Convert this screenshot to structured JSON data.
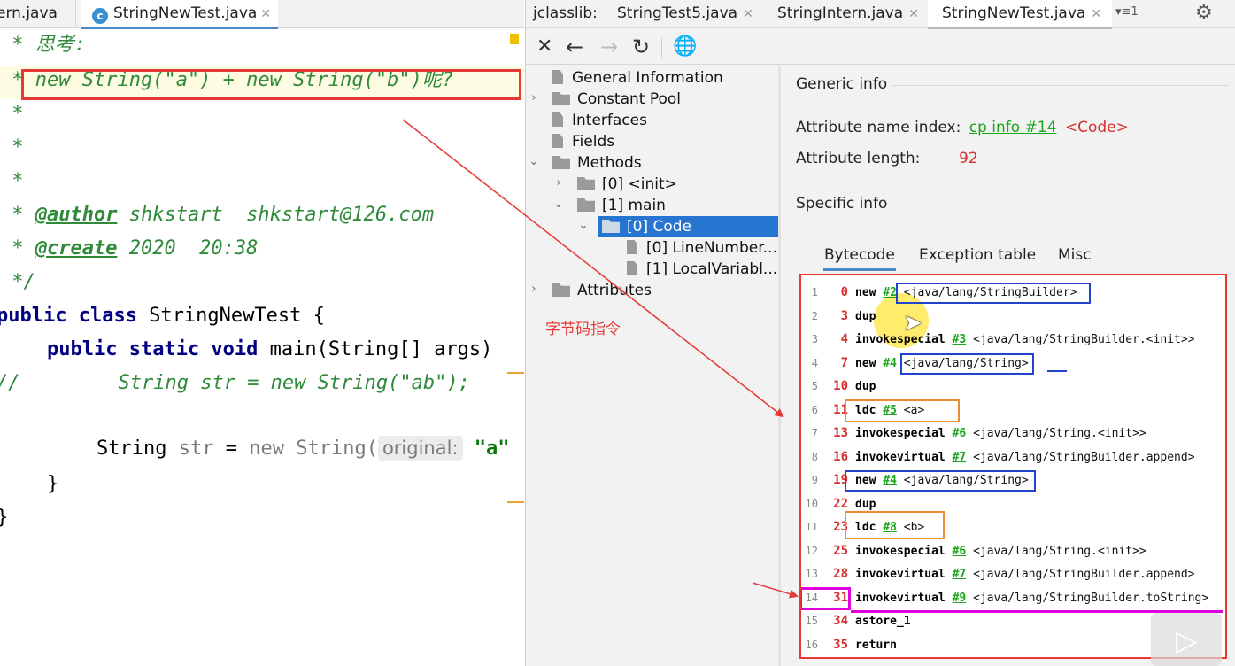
{
  "editor": {
    "tabs": [
      {
        "label": "ern.java"
      },
      {
        "label": "StringNewTest.java",
        "active": true
      }
    ],
    "lines": {
      "l1": " * 思考:",
      "l2_star": " *",
      "l2_text": "new String(\"a\") + new String(\"b\")呢?",
      "l3": " *",
      "l4": " *",
      "l5": " *",
      "l6_star": " * ",
      "l6_tag": "@author",
      "l6_text": " shkstart  shkstart@126.com",
      "l7_star": " * ",
      "l7_tag": "@create",
      "l7_text": " 2020  20:38",
      "l8": " */",
      "l9_kw": "public class",
      "l9_text": " StringNewTest {",
      "l10_kw": "public static void",
      "l10_text": " main(String[] args)",
      "l11_prefix": "//",
      "l11_text": "String str = new String(\"ab\");",
      "l12_type": "String",
      "l12_var": "str",
      "l12_eq": " = ",
      "l12_new": "new",
      "l12_cls": " String(",
      "l12_hint": "original:",
      "l12_arg": "\"a\"",
      "l13": "}",
      "l14": "}"
    }
  },
  "jclasslib": {
    "label": "jclasslib:",
    "tabs": [
      {
        "label": "StringTest5.java"
      },
      {
        "label": "StringIntern.java"
      },
      {
        "label": "StringNewTest.java",
        "active": true
      }
    ],
    "tab_list_label": "▾≡1",
    "toolbar": [
      "close-icon",
      "back-icon",
      "forward-icon",
      "reload-icon",
      "web-icon"
    ],
    "tree": {
      "general": "General Information",
      "constant_pool": "Constant Pool",
      "interfaces": "Interfaces",
      "fields": "Fields",
      "methods": "Methods",
      "init": "[0] <init>",
      "main": "[1] main",
      "code": "[0] Code",
      "line_number": "[0] LineNumber...",
      "local_var": "[1] LocalVariabl...",
      "attributes": "Attributes"
    },
    "annotation": "字节码指令",
    "generic_info": "Generic info",
    "attr_name_label": "Attribute name index:",
    "attr_name_link": "cp info #14",
    "attr_name_value": "<Code>",
    "attr_len_label": "Attribute length:",
    "attr_len_value": "92",
    "specific_info": "Specific info",
    "subtabs": [
      "Bytecode",
      "Exception table",
      "Misc"
    ],
    "bytecode": [
      {
        "n": "1",
        "off": "0",
        "op": "new",
        "cp": "#2",
        "arg": "<java/lang/StringBuilder>"
      },
      {
        "n": "2",
        "off": "3",
        "op": "dup",
        "cp": "",
        "arg": ""
      },
      {
        "n": "3",
        "off": "4",
        "op": "invokespecial",
        "cp": "#3",
        "arg": "<java/lang/StringBuilder.<init>>"
      },
      {
        "n": "4",
        "off": "7",
        "op": "new",
        "cp": "#4",
        "arg": "<java/lang/String>"
      },
      {
        "n": "5",
        "off": "10",
        "op": "dup",
        "cp": "",
        "arg": ""
      },
      {
        "n": "6",
        "off": "11",
        "op": "ldc",
        "cp": "#5",
        "arg": "<a>"
      },
      {
        "n": "7",
        "off": "13",
        "op": "invokespecial",
        "cp": "#6",
        "arg": "<java/lang/String.<init>>"
      },
      {
        "n": "8",
        "off": "16",
        "op": "invokevirtual",
        "cp": "#7",
        "arg": "<java/lang/StringBuilder.append>"
      },
      {
        "n": "9",
        "off": "19",
        "op": "new",
        "cp": "#4",
        "arg": "<java/lang/String>"
      },
      {
        "n": "10",
        "off": "22",
        "op": "dup",
        "cp": "",
        "arg": ""
      },
      {
        "n": "11",
        "off": "23",
        "op": "ldc",
        "cp": "#8",
        "arg": "<b>"
      },
      {
        "n": "12",
        "off": "25",
        "op": "invokespecial",
        "cp": "#6",
        "arg": "<java/lang/String.<init>>"
      },
      {
        "n": "13",
        "off": "28",
        "op": "invokevirtual",
        "cp": "#7",
        "arg": "<java/lang/StringBuilder.append>"
      },
      {
        "n": "14",
        "off": "31",
        "op": "invokevirtual",
        "cp": "#9",
        "arg": "<java/lang/StringBuilder.toString>"
      },
      {
        "n": "15",
        "off": "34",
        "op": "astore_1",
        "cp": "",
        "arg": ""
      },
      {
        "n": "16",
        "off": "35",
        "op": "return",
        "cp": "",
        "arg": ""
      }
    ]
  },
  "colors": {
    "annotation_red": "#e53935",
    "box_blue": "#2244cc",
    "box_orange": "#f08c30",
    "box_magenta": "#e000e0",
    "selection_blue": "#2675d0"
  }
}
